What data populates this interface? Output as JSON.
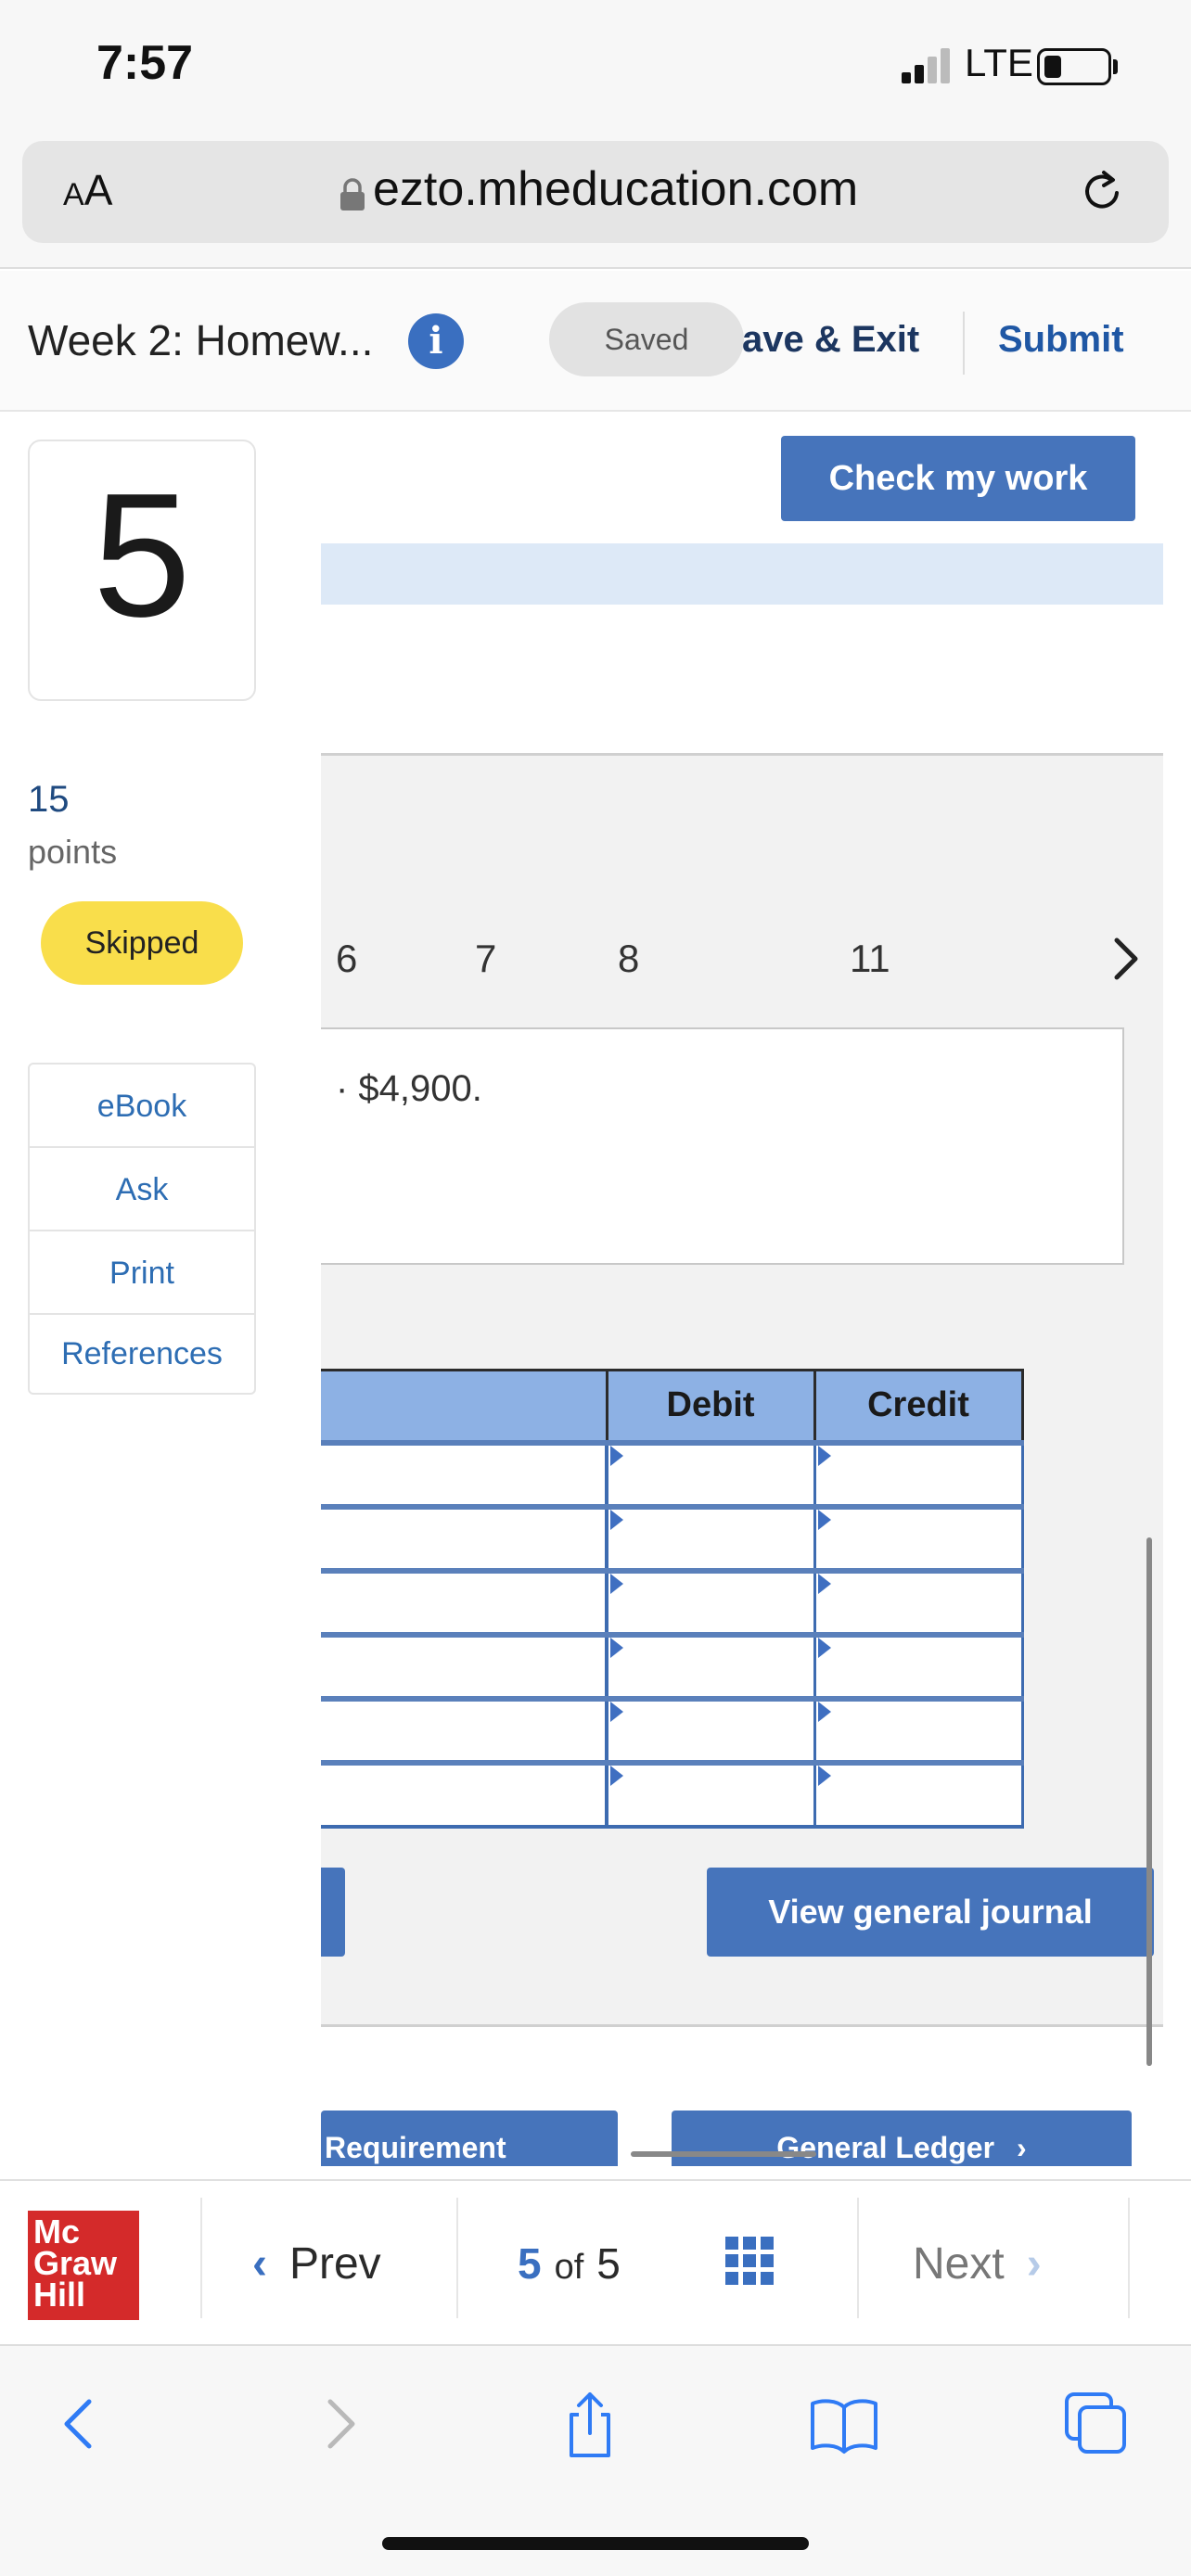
{
  "status_bar": {
    "time": "7:57",
    "network": "LTE"
  },
  "browser": {
    "text_size_label": "AA",
    "url": "ezto.mheducation.com"
  },
  "assignment": {
    "title": "Week 2: Homew...",
    "saved_label": "Saved",
    "save_exit_label": "ave & Exit",
    "submit_label": "Submit"
  },
  "question": {
    "number": "5",
    "points": "15",
    "points_label": "points",
    "status": "Skipped",
    "tools": [
      "eBook",
      "Ask",
      "Print",
      "References"
    ]
  },
  "main": {
    "check_label": "Check my work",
    "tabs": [
      "6",
      "7",
      "8",
      "11"
    ],
    "info_text": "· $4,900.",
    "journal": {
      "headers": [
        "",
        "Debit",
        "Credit"
      ],
      "rows": [
        [
          "",
          "",
          ""
        ],
        [
          "",
          "",
          ""
        ],
        [
          "",
          "",
          ""
        ],
        [
          "",
          "",
          ""
        ],
        [
          "",
          "",
          ""
        ],
        [
          "",
          "",
          ""
        ]
      ]
    },
    "view_journal_label": "View general journal",
    "requirement_label": "Requirement",
    "general_ledger_label": "General Ledger"
  },
  "bottom_nav": {
    "logo_lines": [
      "Mc",
      "Graw",
      "Hill"
    ],
    "prev_label": "Prev",
    "current_page": "5",
    "of_label": "of",
    "total_pages": "5",
    "next_label": "Next"
  },
  "colors": {
    "accent": "#4674bb",
    "badge": "#f9de4b",
    "table_header": "#8db1e4",
    "brand": "#d42a2a"
  }
}
